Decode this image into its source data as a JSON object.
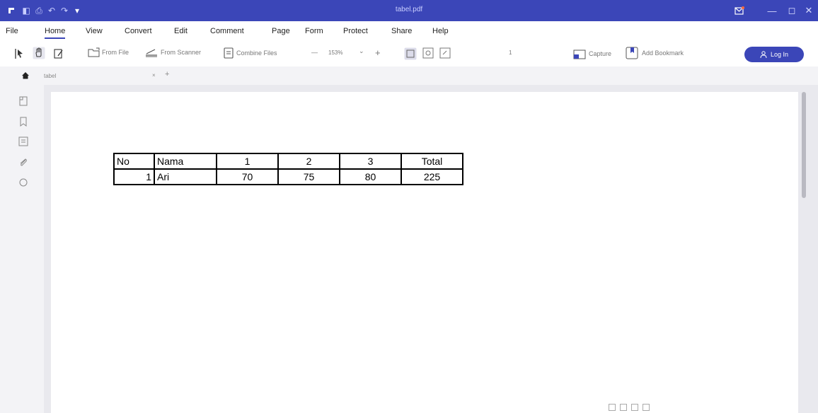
{
  "window": {
    "title": "tabel.pdf",
    "minimize": "—",
    "restore": "◻",
    "close": "✕"
  },
  "quick_access": [
    "◧",
    "⎙",
    "↶",
    "↷",
    "▾"
  ],
  "menu": {
    "items": [
      "File",
      "Home",
      "View",
      "Convert",
      "Edit",
      "Comment",
      "Page",
      "Form",
      "Protect",
      "Share",
      "Help"
    ],
    "active": "Home"
  },
  "toolbar": {
    "from_file": "From File",
    "from_scanner": "From Scanner",
    "combine_files": "Combine Files",
    "zoom_minus": "—",
    "zoom_value": "153%",
    "zoom_dropdown": "⌄",
    "zoom_plus": "+",
    "page_number": "1",
    "capture": "Capture",
    "add_bookmark": "Add Bookmark",
    "login": "Log In"
  },
  "tabs": {
    "home_icon": "home-icon",
    "doc_tab": "tabel",
    "close_tab": "×",
    "new_tab": "+"
  },
  "document": {
    "table": {
      "header": [
        "No",
        "Nama",
        "1",
        "2",
        "3",
        "Total"
      ],
      "rows": [
        [
          "1",
          "Ari",
          "70",
          "75",
          "80",
          "225"
        ]
      ]
    }
  },
  "colors": {
    "brand": "#3b46b8",
    "titlebar": "#3b46b8"
  }
}
